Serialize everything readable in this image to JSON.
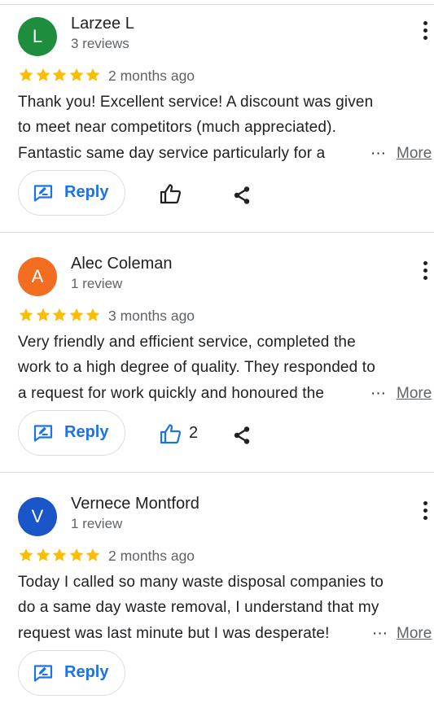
{
  "colors": {
    "accent": "#1a73e8",
    "star": "#fbbc04",
    "text_primary": "#202124",
    "text_secondary": "#5f6368",
    "divider": "#dadce0"
  },
  "reviews": [
    {
      "initial": "L",
      "avatar_color": "#1e8e3e",
      "name": "Larzee L",
      "review_count": "3 reviews",
      "rating": 5,
      "time_ago": "2 months ago",
      "lines": [
        "Thank you! Excellent service! A discount was given",
        "to meet near competitors (much appreciated).",
        "Fantastic same day service particularly for a"
      ],
      "ellipsis": "···",
      "more_label": "More",
      "reply_label": "Reply",
      "like_count": "",
      "liked": false
    },
    {
      "initial": "A",
      "avatar_color": "#f26d1f",
      "name": "Alec Coleman",
      "review_count": "1 review",
      "rating": 5,
      "time_ago": "3 months ago",
      "lines": [
        "Very friendly and efficient service, completed the",
        "work to a high degree of quality. They responded to",
        "a request for work quickly and honoured the"
      ],
      "ellipsis": "···",
      "more_label": "More",
      "reply_label": "Reply",
      "like_count": "2",
      "liked": true
    },
    {
      "initial": "V",
      "avatar_color": "#1a56c8",
      "name": "Vernece Montford",
      "review_count": "1 review",
      "rating": 5,
      "time_ago": "2 months ago",
      "lines": [
        "Today I called so many waste disposal companies to",
        "do a same day waste removal, I understand that my",
        "request was last minute but I was desperate!"
      ],
      "ellipsis": "···",
      "more_label": "More",
      "reply_label": "Reply",
      "like_count": "",
      "liked": false
    }
  ]
}
